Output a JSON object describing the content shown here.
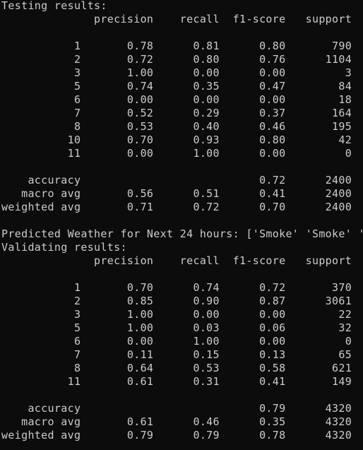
{
  "terminal": {
    "lines": [
      "Testing results:",
      "              precision    recall  f1-score   support",
      "",
      "           1       0.78      0.81      0.80       790",
      "           2       0.72      0.80      0.76      1104",
      "           3       1.00      0.00      0.00         3",
      "           5       0.74      0.35      0.47        84",
      "           6       0.00      0.00      0.00        18",
      "           7       0.52      0.29      0.37       164",
      "           8       0.53      0.40      0.46       195",
      "          10       0.70      0.93      0.80        42",
      "          11       0.00      1.00      0.00         0",
      "",
      "    accuracy                           0.72      2400",
      "   macro avg       0.56      0.51      0.41      2400",
      "weighted avg       0.71      0.72      0.70      2400",
      "",
      "Predicted Weather for Next 24 hours: ['Smoke' 'Smoke' 'Sm",
      "Validating results:",
      "              precision    recall  f1-score   support",
      "",
      "           1       0.70      0.74      0.72       370",
      "           2       0.85      0.90      0.87      3061",
      "           3       1.00      0.00      0.00        22",
      "           5       1.00      0.03      0.06        32",
      "           6       0.00      1.00      0.00         0",
      "           7       0.11      0.15      0.13        65",
      "           8       0.64      0.53      0.58       621",
      "          11       0.61      0.31      0.41       149",
      "",
      "    accuracy                           0.79      4320",
      "   macro avg       0.61      0.46      0.35      4320",
      "weighted avg       0.79      0.79      0.78      4320"
    ]
  }
}
